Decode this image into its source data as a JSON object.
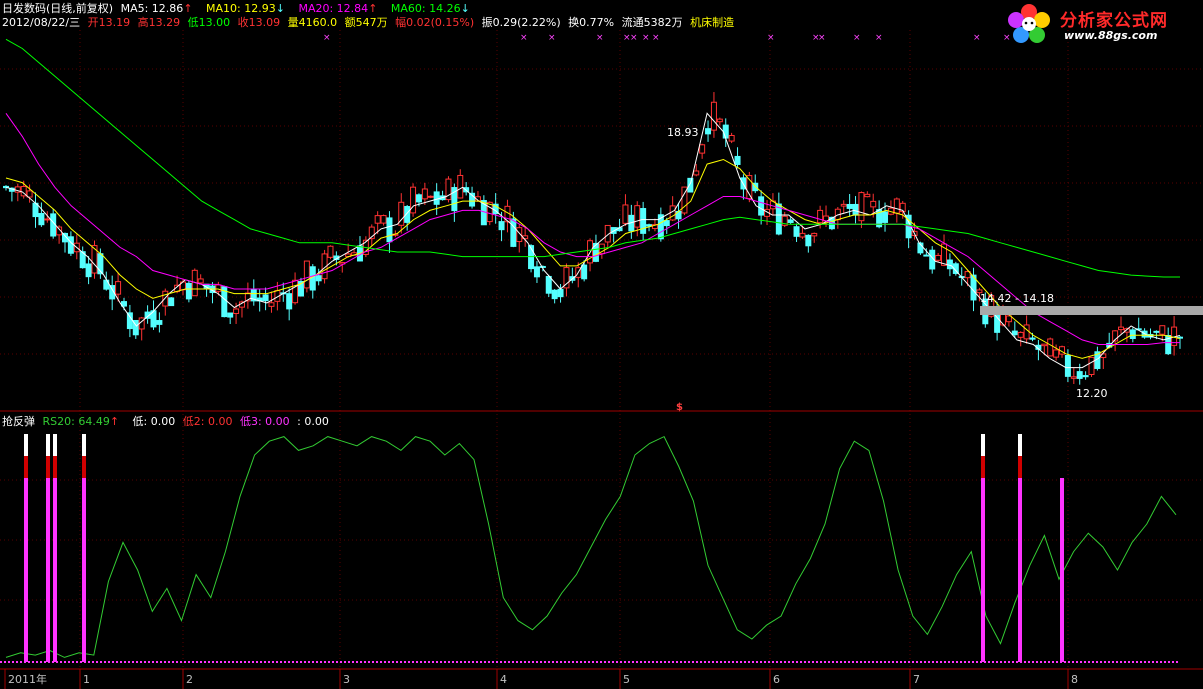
{
  "header": {
    "stock_name": "日发数码(日线,前复权)",
    "ma5": "MA5: 12.86",
    "ma10": "MA10: 12.93",
    "ma20": "MA20: 12.84",
    "ma60": "MA60: 14.26",
    "date": "2012/08/22/三",
    "open": "开13.19",
    "high": "高13.29",
    "low": "低13.00",
    "close": "收13.09",
    "volume": "量4160.0",
    "amount": "额547万",
    "change": "幅0.02(0.15%)",
    "amplitude": "振0.29(2.22%)",
    "turnover": "换0.77%",
    "float": "流通5382万",
    "sector": "机床制造"
  },
  "indicator_header": {
    "name": "抢反弹",
    "rs20": "RS20: 64.49",
    "low1": "低: 0.00",
    "low2": "低2: 0.00",
    "low3": "低3: 0.00",
    "extra": ": 0.00"
  },
  "logo": {
    "title": "分析家公式网",
    "url": "www.88gs.com"
  },
  "colors": {
    "up": "#ff3232",
    "down": "#54ffff",
    "ma5": "#ffffff",
    "ma10": "#ffff00",
    "ma20": "#ff00ff",
    "ma60": "#00ff00",
    "rs_line": "#33cc33",
    "grid": "#800000",
    "bar_magenta": "#ff33ff"
  },
  "chart_data": [
    {
      "type": "candlestick",
      "title": "日发数码(日线,前复权)",
      "annotations": [
        "18.93",
        "14.42 - 14.18",
        "12.20"
      ],
      "marker": "$",
      "x_ticks": [
        "2011年",
        "1",
        "2",
        "3",
        "4",
        "5",
        "6",
        "7",
        "8"
      ],
      "ylim": [
        11.6,
        19.6
      ],
      "series": [
        {
          "name": "MA5",
          "values": [
            16.2,
            16.1,
            15.8,
            15.4,
            15.0,
            14.7,
            14.3,
            13.7,
            13.2,
            13.5,
            13.9,
            14.2,
            14.1,
            13.9,
            13.6,
            13.8,
            13.7,
            13.9,
            14.1,
            14.3,
            14.6,
            14.8,
            15.0,
            15.3,
            15.4,
            15.8,
            15.9,
            16.0,
            16.2,
            15.9,
            15.7,
            15.4,
            15.0,
            14.4,
            14.0,
            14.3,
            14.9,
            15.2,
            15.4,
            15.5,
            15.5,
            15.7,
            16.3,
            17.8,
            17.4,
            16.4,
            15.8,
            15.6,
            15.6,
            15.3,
            15.4,
            15.6,
            15.7,
            15.6,
            15.8,
            15.7,
            15.0,
            14.6,
            14.5,
            14.1,
            13.7,
            13.3,
            12.9,
            12.8,
            12.5,
            12.3,
            12.3,
            12.5,
            12.9,
            13.2,
            13.0,
            12.9,
            13.0
          ]
        },
        {
          "name": "MA10",
          "values": [
            16.4,
            16.3,
            16.0,
            15.7,
            15.3,
            15.0,
            14.7,
            14.3,
            14.0,
            13.8,
            13.9,
            14.0,
            14.0,
            14.0,
            13.9,
            13.9,
            13.9,
            14.0,
            14.1,
            14.3,
            14.5,
            14.7,
            14.8,
            15.1,
            15.2,
            15.5,
            15.7,
            15.8,
            15.9,
            15.9,
            15.8,
            15.6,
            15.3,
            14.9,
            14.5,
            14.5,
            14.7,
            14.9,
            15.2,
            15.3,
            15.4,
            15.6,
            15.9,
            16.7,
            16.8,
            16.6,
            16.2,
            15.9,
            15.7,
            15.5,
            15.4,
            15.5,
            15.6,
            15.6,
            15.7,
            15.6,
            15.3,
            15.0,
            14.8,
            14.4,
            14.0,
            13.6,
            13.3,
            13.0,
            12.8,
            12.6,
            12.5,
            12.6,
            12.8,
            13.0,
            13.0,
            13.0,
            12.93
          ]
        },
        {
          "name": "MA20",
          "values": [
            17.8,
            17.3,
            16.7,
            16.2,
            15.8,
            15.5,
            15.2,
            14.9,
            14.7,
            14.4,
            14.3,
            14.2,
            14.1,
            14.1,
            14.0,
            14.0,
            14.0,
            14.1,
            14.2,
            14.3,
            14.4,
            14.6,
            14.8,
            14.9,
            15.1,
            15.3,
            15.5,
            15.6,
            15.7,
            15.7,
            15.6,
            15.5,
            15.3,
            15.0,
            14.8,
            14.7,
            14.7,
            14.8,
            14.9,
            15.0,
            15.2,
            15.4,
            15.6,
            15.8,
            16.0,
            16.0,
            15.9,
            15.8,
            15.7,
            15.6,
            15.5,
            15.4,
            15.4,
            15.4,
            15.4,
            15.4,
            15.3,
            15.1,
            14.9,
            14.7,
            14.4,
            14.1,
            13.8,
            13.5,
            13.3,
            13.1,
            12.9,
            12.8,
            12.8,
            12.8,
            12.8,
            12.84,
            12.84
          ]
        },
        {
          "name": "MA60",
          "values": [
            19.4,
            19.2,
            18.9,
            18.6,
            18.3,
            18.0,
            17.7,
            17.4,
            17.1,
            16.8,
            16.5,
            16.2,
            15.9,
            15.7,
            15.5,
            15.3,
            15.2,
            15.1,
            15.0,
            15.0,
            15.0,
            14.95,
            14.9,
            14.85,
            14.8,
            14.8,
            14.8,
            14.75,
            14.7,
            14.7,
            14.7,
            14.7,
            14.7,
            14.7,
            14.75,
            14.8,
            14.85,
            14.9,
            15.0,
            15.05,
            15.1,
            15.2,
            15.3,
            15.4,
            15.5,
            15.55,
            15.5,
            15.45,
            15.4,
            15.4,
            15.4,
            15.4,
            15.4,
            15.4,
            15.4,
            15.4,
            15.35,
            15.3,
            15.25,
            15.2,
            15.1,
            15.0,
            14.9,
            14.8,
            14.7,
            14.6,
            14.5,
            14.4,
            14.35,
            14.3,
            14.28,
            14.26,
            14.26
          ]
        }
      ]
    },
    {
      "type": "line",
      "title": "抢反弹",
      "series": [
        {
          "name": "RS20",
          "values": [
            2,
            4,
            3,
            5,
            2,
            4,
            3,
            35,
            52,
            40,
            22,
            32,
            18,
            38,
            28,
            48,
            72,
            90,
            96,
            98,
            92,
            94,
            98,
            96,
            94,
            98,
            96,
            92,
            98,
            96,
            90,
            95,
            88,
            60,
            28,
            18,
            14,
            20,
            30,
            38,
            50,
            62,
            72,
            90,
            95,
            98,
            85,
            70,
            42,
            28,
            14,
            10,
            16,
            20,
            34,
            45,
            60,
            84,
            96,
            92,
            70,
            40,
            20,
            12,
            24,
            38,
            48,
            20,
            8,
            26,
            42,
            55,
            36,
            48,
            56,
            50,
            40,
            52,
            60,
            72,
            64
          ]
        }
      ]
    }
  ]
}
